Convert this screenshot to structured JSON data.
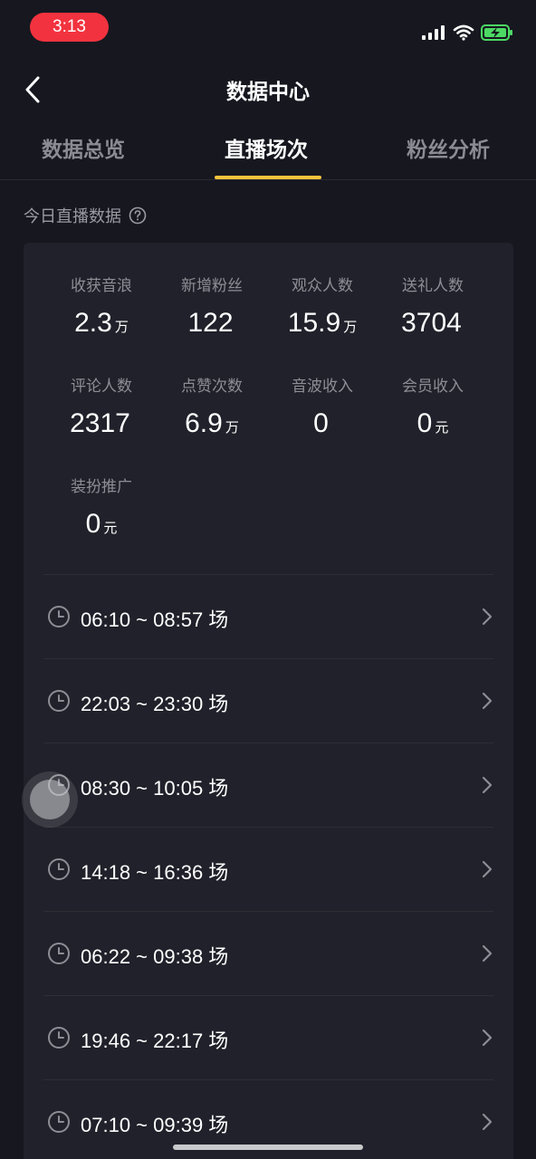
{
  "status_bar": {
    "time": "3:13"
  },
  "nav": {
    "title": "数据中心"
  },
  "tabs": [
    {
      "label": "数据总览",
      "active": false
    },
    {
      "label": "直播场次",
      "active": true
    },
    {
      "label": "粉丝分析",
      "active": false
    }
  ],
  "section": {
    "label": "今日直播数据"
  },
  "stats": [
    {
      "label": "收获音浪",
      "value": "2.3",
      "unit": "万"
    },
    {
      "label": "新增粉丝",
      "value": "122",
      "unit": ""
    },
    {
      "label": "观众人数",
      "value": "15.9",
      "unit": "万"
    },
    {
      "label": "送礼人数",
      "value": "3704",
      "unit": ""
    },
    {
      "label": "评论人数",
      "value": "2317",
      "unit": ""
    },
    {
      "label": "点赞次数",
      "value": "6.9",
      "unit": "万"
    },
    {
      "label": "音波收入",
      "value": "0",
      "unit": ""
    },
    {
      "label": "会员收入",
      "value": "0",
      "unit": "元"
    },
    {
      "label": "装扮推广",
      "value": "0",
      "unit": "元"
    }
  ],
  "sessions": [
    {
      "time": "06:10 ~ 08:57",
      "suffix": "场"
    },
    {
      "time": "22:03 ~ 23:30",
      "suffix": "场"
    },
    {
      "time": "08:30 ~ 10:05",
      "suffix": "场"
    },
    {
      "time": "14:18 ~ 16:36",
      "suffix": "场"
    },
    {
      "time": "06:22 ~ 09:38",
      "suffix": "场"
    },
    {
      "time": "19:46 ~ 22:17",
      "suffix": "场"
    },
    {
      "time": "07:10 ~ 09:39",
      "suffix": "场"
    }
  ],
  "colors": {
    "accent": "#f7c43c",
    "background": "#16171f",
    "card": "#20212a",
    "status_pill": "#f2333f",
    "battery": "#4cd964"
  }
}
